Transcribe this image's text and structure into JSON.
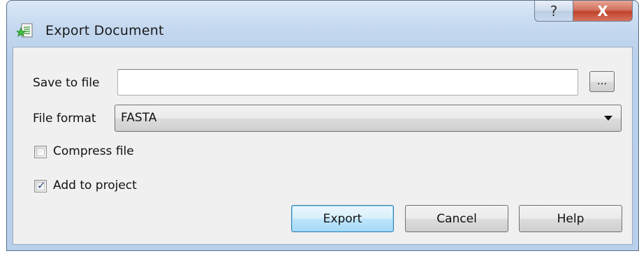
{
  "window": {
    "title": "Export Document",
    "title_help_glyph": "?",
    "title_close_glyph": "X",
    "app_icon": "document-star-icon"
  },
  "form": {
    "save_label": "Save to file",
    "save_value": "",
    "browse_label": "...",
    "format_label": "File format",
    "format_selected": "FASTA",
    "compress_label": "Compress file",
    "compress_checked": false,
    "add_label": "Add to project",
    "add_checked": true
  },
  "buttons": {
    "export": "Export",
    "cancel": "Cancel",
    "help": "Help"
  },
  "colors": {
    "title_gradient": "#c4d8ef",
    "close_button": "#c0432c",
    "default_button": "#bee6fd"
  }
}
